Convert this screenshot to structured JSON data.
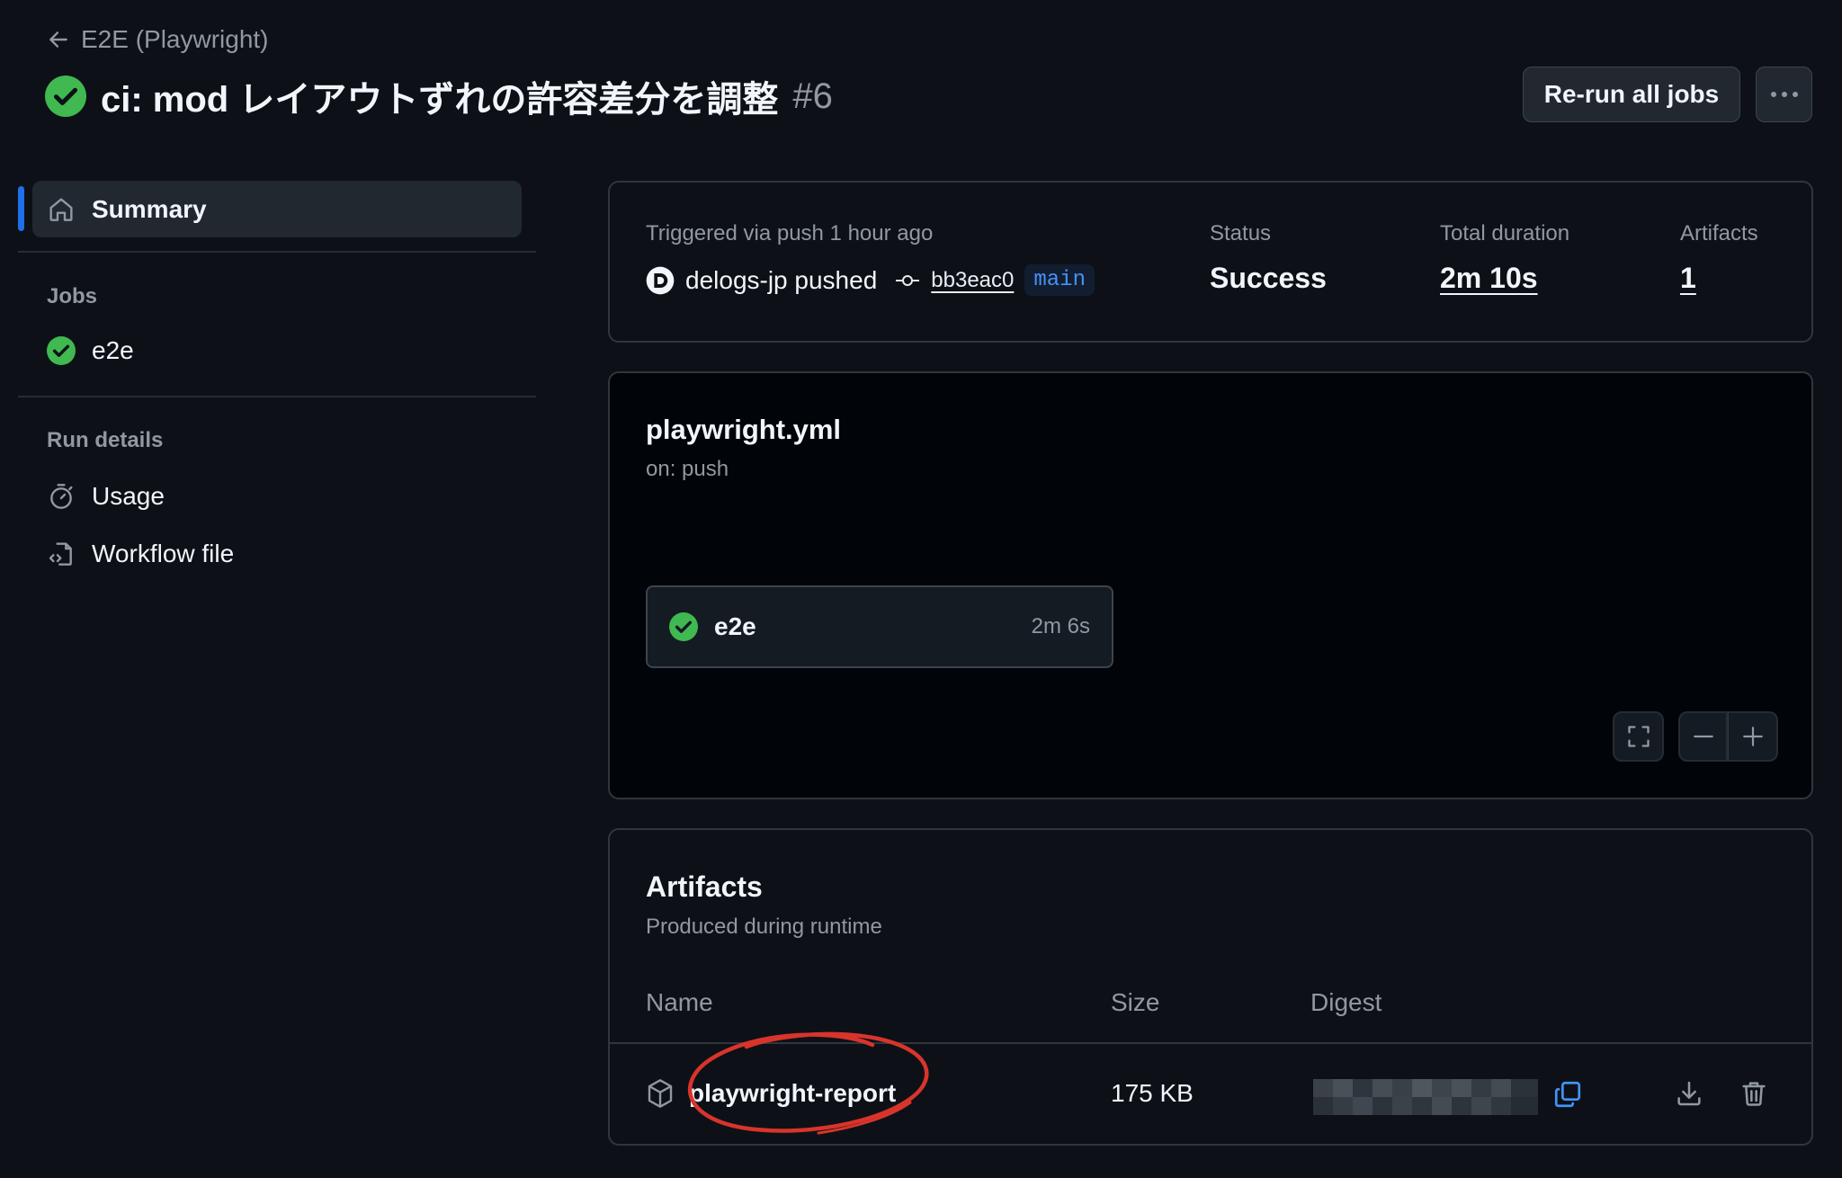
{
  "header": {
    "back_label": "E2E (Playwright)",
    "title": "ci: mod レイアウトずれの許容差分を調整",
    "run_number": "#6",
    "rerun_label": "Re-run all jobs",
    "more_label": "···"
  },
  "sidebar": {
    "summary_label": "Summary",
    "jobs_heading": "Jobs",
    "jobs": [
      {
        "label": "e2e",
        "status": "success"
      }
    ],
    "run_details_heading": "Run details",
    "run_details": [
      {
        "label": "Usage",
        "icon": "stopwatch-icon"
      },
      {
        "label": "Workflow file",
        "icon": "file-code-icon"
      }
    ]
  },
  "summary": {
    "trigger_text": "Triggered via push 1 hour ago",
    "actor_text": "delogs-jp pushed",
    "commit_sha": "bb3eac0",
    "branch": "main",
    "status_label": "Status",
    "status_value": "Success",
    "duration_label": "Total duration",
    "duration_value": "2m 10s",
    "artifacts_label": "Artifacts",
    "artifacts_value": "1"
  },
  "workflow": {
    "file_name": "playwright.yml",
    "trigger": "on: push",
    "job_name": "e2e",
    "job_duration": "2m 6s"
  },
  "artifacts": {
    "title": "Artifacts",
    "subtitle": "Produced during runtime",
    "columns": {
      "name": "Name",
      "size": "Size",
      "digest": "Digest"
    },
    "rows": [
      {
        "name": "playwright-report",
        "size": "175 KB"
      }
    ]
  },
  "colors": {
    "background": "#0d1117",
    "success": "#3fb950",
    "accent": "#1f6feb",
    "link": "#4493f8",
    "annotation": "#d9342b"
  }
}
